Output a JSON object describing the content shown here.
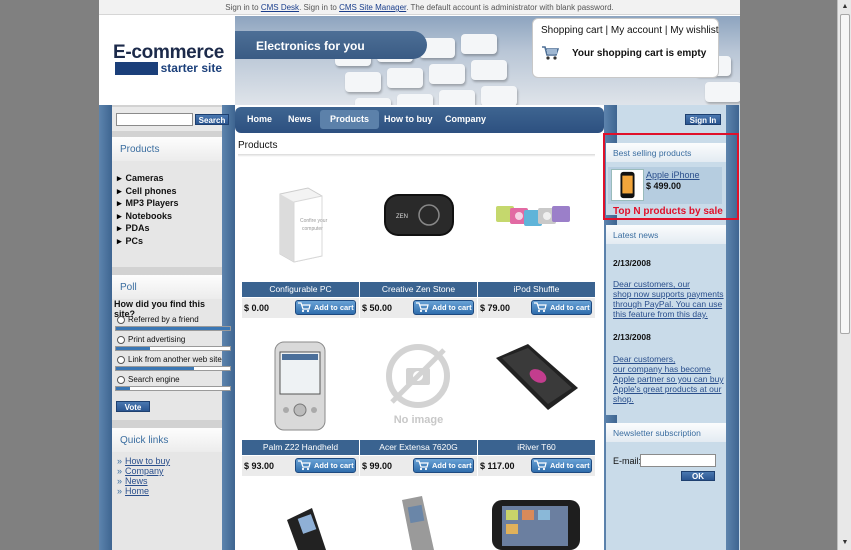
{
  "topbar": {
    "t1": "Sign in to ",
    "l1": "CMS Desk",
    "t2": ". Sign in to ",
    "l2": "CMS Site Manager",
    "t3": ". The default account is administrator with blank password."
  },
  "logo": {
    "line1": "E-commerce",
    "line2": "starter site"
  },
  "banner": {
    "title": "Electronics for you"
  },
  "cart": {
    "link_cart": "Shopping cart",
    "link_account": "My account",
    "link_wishlist": "My wishlist",
    "separator": "|",
    "empty_text": "Your shopping cart is empty"
  },
  "search": {
    "button": "Search",
    "placeholder": ""
  },
  "nav": {
    "items": [
      "Home",
      "News",
      "Products",
      "How to buy",
      "Company"
    ],
    "active": "Products"
  },
  "categories": {
    "title": "Products",
    "items": [
      "Cameras",
      "Cell phones",
      "MP3 Players",
      "Notebooks",
      "PDAs",
      "PCs"
    ]
  },
  "poll": {
    "title": "Poll",
    "question": "How did you find this site?",
    "options": [
      {
        "label": "Referred by a friend",
        "share": 1.0
      },
      {
        "label": "Print advertising",
        "share": 0.3
      },
      {
        "label": "Link from another web site",
        "share": 0.68
      },
      {
        "label": "Search engine",
        "share": 0.12
      }
    ],
    "vote": "Vote"
  },
  "quicklinks": {
    "title": "Quick links",
    "items": [
      "How to buy",
      "Company",
      "News",
      "Home"
    ]
  },
  "products": {
    "title": "Products",
    "add_label": "Add to cart",
    "items": [
      {
        "name": "Configurable PC",
        "price": "$ 0.00",
        "image": "pc-tower"
      },
      {
        "name": "Creative Zen Stone",
        "price": "$ 50.00",
        "image": "mp3-player"
      },
      {
        "name": "iPod Shuffle",
        "price": "$ 79.00",
        "image": "ipod-shuffle"
      },
      {
        "name": "Palm Z22 Handheld",
        "price": "$ 93.00",
        "image": "pda"
      },
      {
        "name": "Acer Extensa 7620G",
        "price": "$ 99.00",
        "image": "no-image"
      },
      {
        "name": "iRiver T60",
        "price": "$ 117.00",
        "image": "iriver"
      }
    ],
    "no_image_text": "No image"
  },
  "signin": {
    "button": "Sign In"
  },
  "best": {
    "title": "Best selling products",
    "item_name": "Apple iPhone",
    "item_price": "$ 499.00",
    "annotation": "Top N products by sale"
  },
  "news": {
    "title": "Latest news",
    "entries": [
      {
        "date": "2/13/2008",
        "lines": [
          "Dear customers, our",
          "shop now supports payments",
          "through PayPal. You can use",
          "this feature from this day."
        ]
      },
      {
        "date": "2/13/2008",
        "lines": [
          "Dear customers,",
          "our company has become",
          "Apple partner so you can buy",
          "Apple's great products at our",
          "shop."
        ]
      }
    ]
  },
  "newsletter": {
    "title": "Newsletter subscription",
    "label": "E-mail:",
    "button": "OK"
  },
  "colors": {
    "nav_blue": "#2d5080",
    "accent_red": "#e0102a",
    "link_blue": "#2a4f8c"
  }
}
